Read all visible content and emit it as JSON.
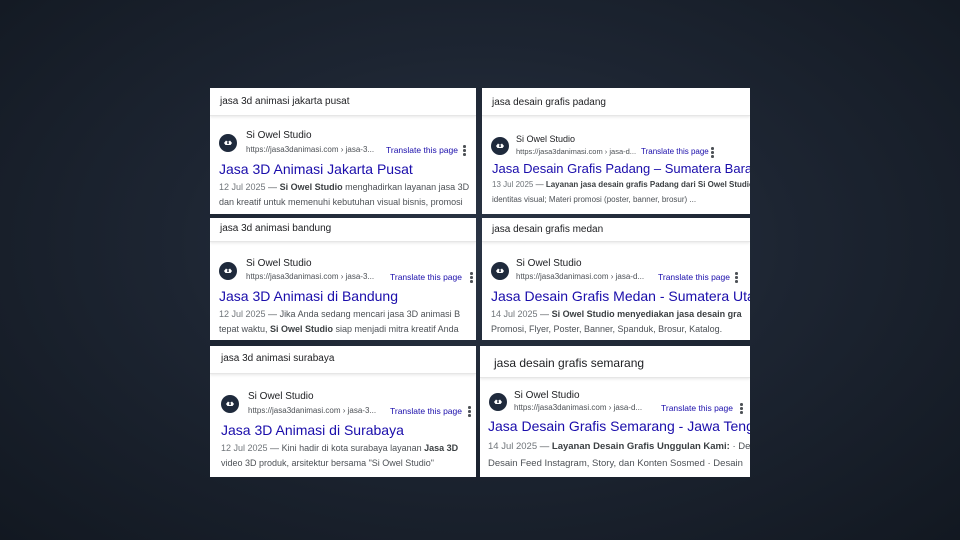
{
  "cards": [
    {
      "query": "jasa 3d animasi jakarta pusat",
      "site_name": "Si Owel Studio",
      "url": "https://jasa3danimasi.com › jasa-3...",
      "translate": "Translate this page",
      "title": "Jasa 3D Animasi Jakarta Pusat",
      "date": "12 Jul 2025",
      "dash": " — ",
      "bold1": "Si Owel Studio",
      "rest1": " menghadirkan layanan jasa 3D",
      "line2_pre": "dan kreatif untuk memenuhi kebutuhan visual bisnis, promosi",
      "bold2": "",
      "line2_post": ""
    },
    {
      "query": "jasa desain grafis padang",
      "site_name": "Si Owel Studio",
      "url": "https://jasa3danimasi.com › jasa-d...",
      "translate": "Translate this page",
      "title": "Jasa Desain Grafis Padang – Sumatera Barat",
      "date": "13 Jul 2025",
      "dash": " — ",
      "bold1": "Layanan jasa desain grafis Padang dari Si Owel Studio",
      "rest1": "",
      "line2_pre": "identitas visual; Materi promosi (poster, banner, brosur) ...",
      "bold2": "",
      "line2_post": ""
    },
    {
      "query": "jasa 3d animasi bandung",
      "site_name": "Si Owel Studio",
      "url": "https://jasa3danimasi.com › jasa-3...",
      "translate": "Translate this page",
      "title": "Jasa 3D Animasi di Bandung",
      "date": "12 Jul 2025",
      "dash": " — ",
      "bold1": "",
      "rest1": "Jika Anda sedang mencari jasa 3D animasi B",
      "line2_pre": "tepat waktu, ",
      "bold2": "Si Owel Studio",
      "line2_post": " siap menjadi mitra kreatif Anda"
    },
    {
      "query": "jasa desain grafis medan",
      "site_name": "Si Owel Studio",
      "url": "https://jasa3danimasi.com › jasa-d...",
      "translate": "Translate this page",
      "title": "Jasa Desain Grafis Medan - Sumatera Utara",
      "date": "14 Jul 2025",
      "dash": " — ",
      "bold1": "Si Owel Studio menyediakan jasa desain gra",
      "rest1": "",
      "line2_pre": "Promosi, Flyer, Poster, Banner, Spanduk, Brosur, Katalog.",
      "bold2": "",
      "line2_post": ""
    },
    {
      "query": "jasa 3d animasi surabaya",
      "site_name": "Si Owel Studio",
      "url": "https://jasa3danimasi.com › jasa-3...",
      "translate": "Translate this page",
      "title": "Jasa 3D Animasi di Surabaya",
      "date": "12 Jul 2025",
      "dash": " — ",
      "bold1": "",
      "rest1": "Kini hadir di kota surabaya layanan ",
      "extra_bold1": "Jasa 3D",
      "line2_pre": "video 3D produk, arsitektur bersama \"Si Owel Studio\"",
      "bold2": "",
      "line2_post": ""
    },
    {
      "query": "jasa desain grafis semarang",
      "site_name": "Si Owel Studio",
      "url": "https://jasa3danimasi.com › jasa-d...",
      "translate": "Translate this page",
      "title": "Jasa Desain Grafis Semarang - Jawa Tengah",
      "date": "14 Jul 2025",
      "dash": " — ",
      "bold1": "Layanan Desain Grafis Unggulan Kami:",
      "rest1": " · De",
      "line2_pre": "Desain Feed Instagram, Story, dan Konten Sosmed · Desain",
      "bold2": "",
      "line2_post": ""
    }
  ]
}
